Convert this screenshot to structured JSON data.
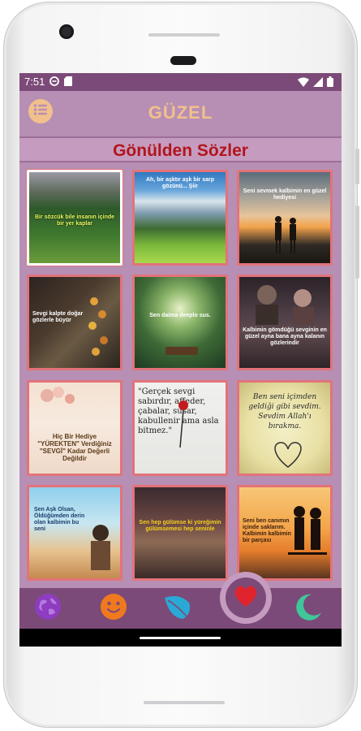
{
  "status_bar": {
    "time": "7:51",
    "left_icons": [
      "data-saver-icon",
      "sd-card-icon"
    ],
    "right_icons": [
      "wifi-icon",
      "signal-icon",
      "battery-icon"
    ]
  },
  "app_bar": {
    "title": "GÜZEL",
    "menu_icon": "list-menu-icon"
  },
  "subtitle": "Gönülden Sözler",
  "colors": {
    "status_bar": "#7c4a78",
    "app_bar": "#b78fb4",
    "title": "#f2c08c",
    "subtitle": "#b2151b",
    "tile_border": "#e2737a",
    "nav": "#7c4a78"
  },
  "tiles": [
    {
      "caption": "Bir sözcük bile insanın içinde bir yer kaplar",
      "selected": true
    },
    {
      "caption": "Ah, bir aşktır aşk bir sarp gözünü... Şiir",
      "selected": false
    },
    {
      "caption": "Seni sevmek kalbimin en güzel hediyesi",
      "selected": false
    },
    {
      "caption": "Sevgi kalpte doğar gözlerle büyür",
      "selected": false
    },
    {
      "caption": "Sen daima deeplo sus.",
      "selected": false
    },
    {
      "caption": "Kalbimin gömdüğü sevginin en güzel ayna bana ayna kalanın gözlerindir",
      "selected": false
    },
    {
      "caption": "Hiç Bir Hediye \"YÜREKTEN\" Verdiğiniz \"SEVGİ\" Kadar Değerli Değildir",
      "selected": false
    },
    {
      "caption": "\"Gerçek sevgi sabırdır, affeder, çabalar, susar, kabullenir ama asla bitmez.\"",
      "selected": false
    },
    {
      "caption": "Ben seni içimden geldiği gibi sevdim. Sevdim Allah'ı bırakma.",
      "selected": false
    },
    {
      "caption": "Sen Aşk Olsan, Öldüğümden derin olan kalbimin bu seni",
      "selected": false
    },
    {
      "caption": "Sen hep gülümse ki yüreğimin gülümsemesi hep seninle",
      "selected": false
    },
    {
      "caption": "Seni ben canımın içinde saklarım. Kalbimin kalbimin bir parçası",
      "selected": false
    }
  ],
  "bottom_nav": {
    "items": [
      {
        "icon": "globe-icon",
        "color": "#8e3cc0"
      },
      {
        "icon": "smiley-icon",
        "color": "#f0791f"
      },
      {
        "icon": "leaf-icon",
        "color": "#2aa9d6"
      },
      {
        "icon": "heart-icon",
        "color": "#e0242d",
        "active": true
      },
      {
        "icon": "moon-icon",
        "color": "#3fc79a"
      }
    ]
  }
}
